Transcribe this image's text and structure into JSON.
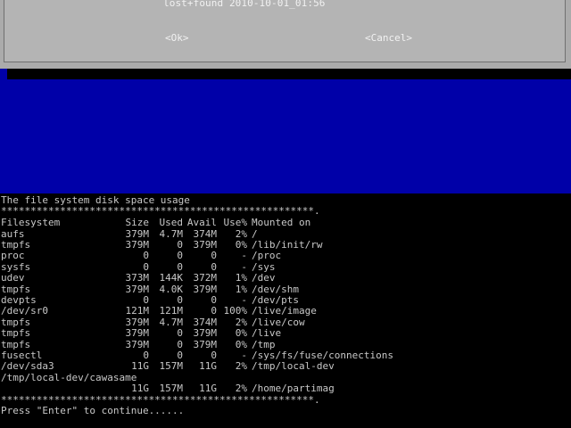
{
  "dialog": {
    "item": "lost+found 2010-10-01_01:56",
    "ok_label": "<Ok>",
    "cancel_label": "<Cancel>"
  },
  "terminal": {
    "title": "The file system disk space usage",
    "separator_top": "*****************************************************.",
    "headers": {
      "filesystem": "Filesystem",
      "size": "Size",
      "used": "Used",
      "avail": "Avail",
      "use": "Use%",
      "mounted": "Mounted on"
    },
    "rows": [
      {
        "fs": "aufs",
        "size": "379M",
        "used": "4.7M",
        "avail": "374M",
        "use": "2%",
        "mount": "/"
      },
      {
        "fs": "tmpfs",
        "size": "379M",
        "used": "0",
        "avail": "379M",
        "use": "0%",
        "mount": "/lib/init/rw"
      },
      {
        "fs": "proc",
        "size": "0",
        "used": "0",
        "avail": "0",
        "use": "-",
        "mount": "/proc"
      },
      {
        "fs": "sysfs",
        "size": "0",
        "used": "0",
        "avail": "0",
        "use": "-",
        "mount": "/sys"
      },
      {
        "fs": "udev",
        "size": "373M",
        "used": "144K",
        "avail": "372M",
        "use": "1%",
        "mount": "/dev"
      },
      {
        "fs": "tmpfs",
        "size": "379M",
        "used": "4.0K",
        "avail": "379M",
        "use": "1%",
        "mount": "/dev/shm"
      },
      {
        "fs": "devpts",
        "size": "0",
        "used": "0",
        "avail": "0",
        "use": "-",
        "mount": "/dev/pts"
      },
      {
        "fs": "/dev/sr0",
        "size": "121M",
        "used": "121M",
        "avail": "0",
        "use": "100%",
        "mount": "/live/image"
      },
      {
        "fs": "tmpfs",
        "size": "379M",
        "used": "4.7M",
        "avail": "374M",
        "use": "2%",
        "mount": "/live/cow"
      },
      {
        "fs": "tmpfs",
        "size": "379M",
        "used": "0",
        "avail": "379M",
        "use": "0%",
        "mount": "/live"
      },
      {
        "fs": "tmpfs",
        "size": "379M",
        "used": "0",
        "avail": "379M",
        "use": "0%",
        "mount": "/tmp"
      },
      {
        "fs": "fusectl",
        "size": "0",
        "used": "0",
        "avail": "0",
        "use": "-",
        "mount": "/sys/fs/fuse/connections"
      },
      {
        "fs": "/dev/sda3",
        "size": "11G",
        "used": "157M",
        "avail": "11G",
        "use": "2%",
        "mount": "/tmp/local-dev"
      },
      {
        "fs": "/tmp/local-dev/cawasame",
        "size": "",
        "used": "",
        "avail": "",
        "use": "",
        "mount": ""
      },
      {
        "fs": "",
        "size": "11G",
        "used": "157M",
        "avail": "11G",
        "use": "2%",
        "mount": "/home/partimag"
      }
    ],
    "separator_bottom": "*****************************************************.",
    "prompt": "Press \"Enter\" to continue......"
  }
}
